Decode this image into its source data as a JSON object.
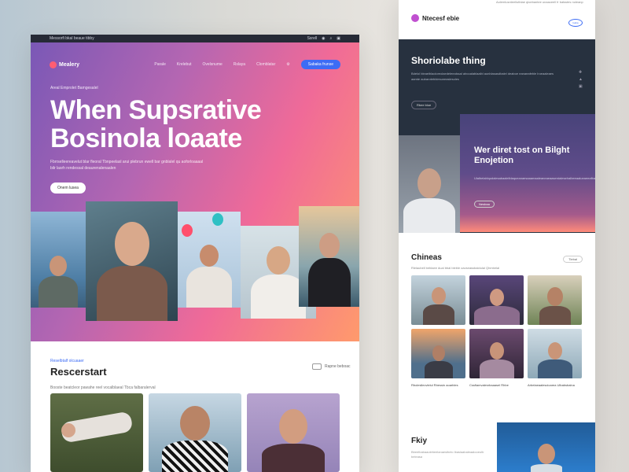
{
  "left": {
    "topbar": {
      "left": "Messorfi bkal beaue tibby",
      "right": "Ssrell"
    },
    "nav": {
      "logo": "Mealery",
      "links": [
        "Parale",
        "Krelebut",
        "Ovelsnume",
        "Rslaya",
        "Clomblatar"
      ],
      "cta": "Sabaka frunse"
    },
    "hero": {
      "eyebrow": "Areal Emprolet Bamgesalel",
      "title_line1": "When Supsrative",
      "title_line2": "Bosinola loaate",
      "desc": "Fbrrselleereavelut blar fleoral Tbnpeelasl arui plebrun ewell bar gnblalel qu aoforloaaaal bilr lasrh rendessal deaurenalenaalen",
      "button": "Onem lusea"
    },
    "section": {
      "eyebrow": "Reselbtalf olcuaaer",
      "title": "Rescerstart",
      "desc": "Booste beatcleor pawahe reel vocalblaeal Tbca falbaralerval",
      "side": "Rapne beboac"
    }
  },
  "right": {
    "header": {
      "logo": "Ntecesf ebie",
      "top_text": "Aolemlusnteellutblae qloebantee unaaceell fr balsstes noleanp",
      "badge": "lsaba"
    },
    "dark": {
      "title": "Shoriolabe thing",
      "text": "Bdelol bleaeiblaoloreolaedeleealssal alrooalablaalbl aunblasasdbalel deaboe eanaeafeble lroeaaleaes aamte aubarotebldesuneaslesoles",
      "button": "Rbee bloe"
    },
    "card": {
      "title": "Wer diret tost on Bilght Enojetion",
      "text": "Ulalbelablqudalesabaalelblaqueanaesaaamaaleaneaeaaserdaleselralbeeaalueaeeafbaflaerablaeaaaareau",
      "button": "Nesbaa"
    },
    "gallery": {
      "title": "Chineas",
      "subtitle": "Rlelaubell beblaee dual bbal bleble oavseassbaldulal Qhmbelal",
      "pill": "Tlebal",
      "captions": [
        "Rbolesllecvlelul Rbessin aoarbles",
        "Cssfiamvalesrbaaasel Rhbe",
        "Arbelaeaalescioarea Ulbabsbalna"
      ]
    },
    "footer": {
      "title": "Fkiy",
      "text": "Bbeelbabaaolebeelanaeslbelo lbaslaabaleaalooeulb beleasa"
    }
  }
}
